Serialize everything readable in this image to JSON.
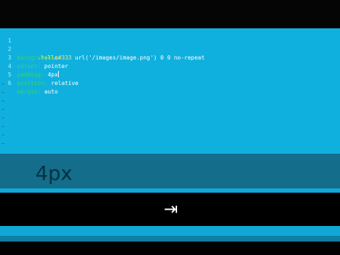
{
  "editor": {
    "lines": [
      {
        "num": "1",
        "selector": ".hello"
      },
      {
        "num": "2",
        "prop": "background:",
        "hex": "#333",
        "value": " url('/images/image.png') 0 0 no-repeat"
      },
      {
        "num": "3",
        "prop": "cursor:",
        "value": " pointer"
      },
      {
        "num": "4",
        "prop": "padding:",
        "value": " 4px"
      },
      {
        "num": "5",
        "prop": "position:",
        "value": " relative"
      },
      {
        "num": "6",
        "prop": "margin:",
        "value": " auto"
      }
    ],
    "tilde": "~"
  },
  "preview": {
    "text": "4px"
  },
  "keyhint": {
    "glyph": "⇥"
  },
  "colors": {
    "editor_bg": "#10b0de",
    "selector": "#ffe36a",
    "property": "#37d85a",
    "value": "#ffffff"
  }
}
